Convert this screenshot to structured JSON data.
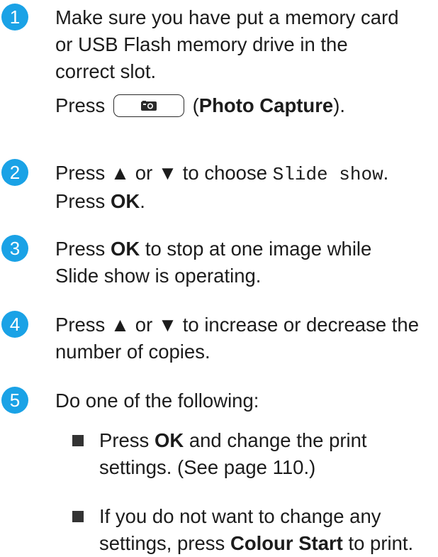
{
  "steps": [
    {
      "number": "1",
      "line1": "Make sure you have put a memory card",
      "line2": "or USB Flash memory drive in the",
      "line3": "correct slot.",
      "press_before": "Press",
      "button_icon": "camera-icon",
      "press_label": "Photo Capture",
      "press_after": ")."
    },
    {
      "number": "2",
      "a": "Press ▲ or ▼ to choose ",
      "mono": "Slide show",
      "b": ".",
      "c": "Press ",
      "ok": "OK",
      "d": "."
    },
    {
      "number": "3",
      "a": "Press ",
      "ok": "OK",
      "b": " to stop at one image while",
      "line2": "Slide show is operating."
    },
    {
      "number": "4",
      "line1": "Press ▲ or ▼ to increase or decrease the",
      "line2": "number of copies."
    },
    {
      "number": "5",
      "line1": "Do one of the following:",
      "bullets": [
        {
          "a": "Press ",
          "bold": "OK",
          "b": " and change the print",
          "line2": "settings. (See page 110.)"
        },
        {
          "line1": "If you do not want to change any",
          "a": "settings, press ",
          "bold": "Colour Start",
          "b": " to print."
        }
      ]
    }
  ],
  "colors": {
    "step_number_bg": "#1aa2e6",
    "text": "#1c1c1c"
  }
}
